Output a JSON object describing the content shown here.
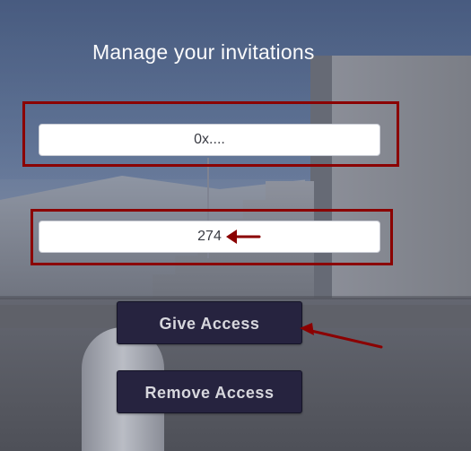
{
  "screen": {
    "title": "Manage your invitations"
  },
  "inputs": {
    "address": {
      "value": "0x...."
    },
    "token_id": {
      "value": "274"
    }
  },
  "buttons": {
    "give_access": "Give Access",
    "remove_access": "Remove Access"
  },
  "colors": {
    "highlight": "#8b0000",
    "button_bg": "#26233f",
    "button_text": "#d7d7dd"
  },
  "icons": {
    "annotation_arrows": "arrow-icon"
  }
}
